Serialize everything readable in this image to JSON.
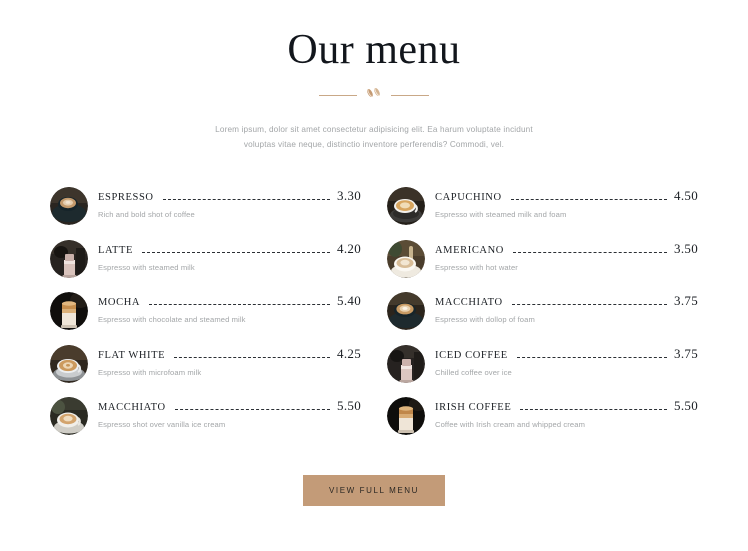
{
  "header": {
    "title": "Our menu",
    "divider_icon": "coffee-beans-icon",
    "subtitle": "Lorem ipsum, dolor sit amet consectetur adipisicing elit. Ea harum voluptate incidunt voluptas vitae neque, distinctio inventore perferendis? Commodi, vel."
  },
  "menu": {
    "left_column": [
      {
        "name": "ESPRESSO",
        "price": "3.30",
        "description": "Rich and bold shot of coffee",
        "thumb": "espresso-cup-photo"
      },
      {
        "name": "LATTE",
        "price": "4.20",
        "description": "Espresso with steamed milk",
        "thumb": "latte-glass-photo"
      },
      {
        "name": "MOCHA",
        "price": "5.40",
        "description": "Espresso with chocolate and steamed milk",
        "thumb": "mocha-glass-photo"
      },
      {
        "name": "FLAT WHITE",
        "price": "4.25",
        "description": "Espresso with microfoam milk",
        "thumb": "flat-white-cup-photo"
      },
      {
        "name": "MACCHIATO",
        "price": "5.50",
        "description": "Espresso shot over vanilla ice cream",
        "thumb": "macchiato-cup-photo"
      }
    ],
    "right_column": [
      {
        "name": "CAPUCHINO",
        "price": "4.50",
        "description": "Espresso with steamed milk and foam",
        "thumb": "capuchino-cup-photo"
      },
      {
        "name": "AMERICANO",
        "price": "3.50",
        "description": "Espresso with hot water",
        "thumb": "americano-cup-photo"
      },
      {
        "name": "MACCHIATO",
        "price": "3.75",
        "description": "Espresso with dollop of foam",
        "thumb": "macchiato-foam-cup-photo"
      },
      {
        "name": "ICED COFFEE",
        "price": "3.75",
        "description": "Chilled coffee over ice",
        "thumb": "iced-coffee-glass-photo"
      },
      {
        "name": "IRISH COFFEE",
        "price": "5.50",
        "description": "Coffee with Irish cream and whipped cream",
        "thumb": "irish-coffee-glass-photo"
      }
    ]
  },
  "footer": {
    "cta_label": "View full menu"
  },
  "colors": {
    "background": "#ffffff",
    "title": "#12161c",
    "muted_text": "#a3a6a8",
    "accent": "#c39b78",
    "divider": "#c9a887",
    "leader_dash": "#2b2f34"
  }
}
